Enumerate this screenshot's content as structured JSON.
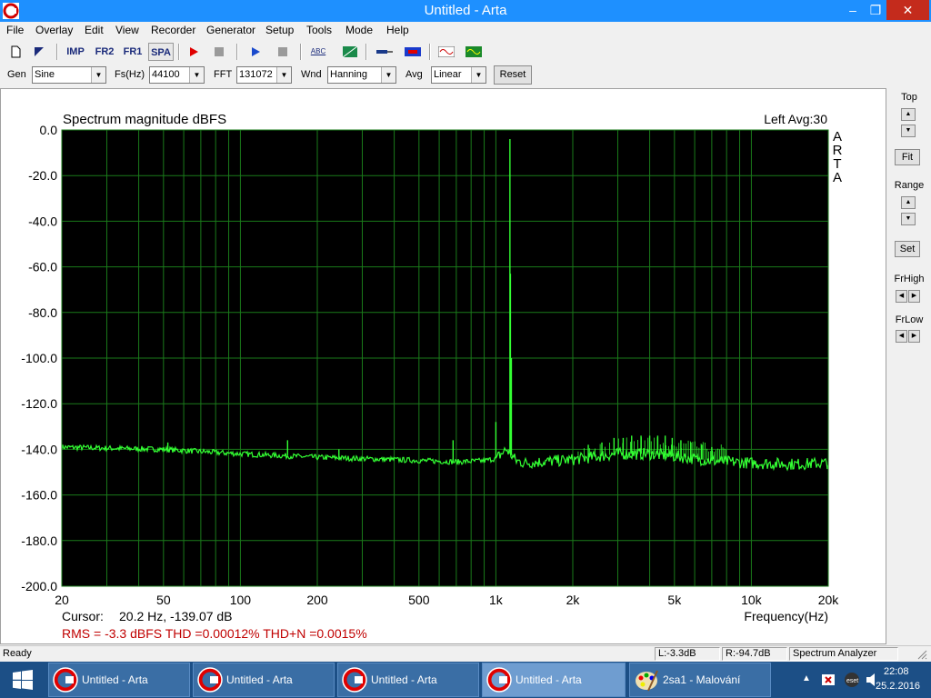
{
  "window": {
    "title": "Untitled - Arta",
    "minimize": "‒",
    "restore": "❐",
    "close": "✕"
  },
  "menu": [
    "File",
    "Overlay",
    "Edit",
    "View",
    "Recorder",
    "Generator",
    "Setup",
    "Tools",
    "Mode",
    "Help"
  ],
  "toolbar": {
    "imp": "IMP",
    "fr2": "FR2",
    "fr1": "FR1",
    "spa": "SPA",
    "abc": "ABC"
  },
  "controls": {
    "gen_label": "Gen",
    "gen_value": "Sine",
    "fs_label": "Fs(Hz)",
    "fs_value": "44100",
    "fft_label": "FFT",
    "fft_value": "131072",
    "wnd_label": "Wnd",
    "wnd_value": "Hanning",
    "avg_label": "Avg",
    "avg_value": "Linear",
    "reset_label": "Reset"
  },
  "plot": {
    "cursor_label": "Cursor:",
    "cursor_value": "20.2 Hz, -139.07 dB",
    "rms_line": "RMS =   -3.3 dBFS   THD =0.00012%   THD+N =0.0015%",
    "watermark": [
      "A",
      "R",
      "T",
      "A"
    ],
    "colors": {
      "background": "#000000",
      "grid": "#1a7a1a",
      "trace": "#33ff33",
      "readout": "#c00000"
    }
  },
  "chart_data": {
    "type": "line",
    "title": "Spectrum magnitude dBFS",
    "channel_info": "Left  Avg:30",
    "xlabel": "Frequency(Hz)",
    "ylabel": "",
    "x_scale": "log",
    "xlim": [
      20,
      20000
    ],
    "ylim": [
      -200,
      0
    ],
    "x_ticks": [
      20,
      50,
      100,
      200,
      500,
      1000,
      2000,
      5000,
      10000,
      20000
    ],
    "x_tick_labels": [
      "20",
      "50",
      "100",
      "200",
      "500",
      "1k",
      "2k",
      "5k",
      "10k",
      "20k"
    ],
    "y_ticks": [
      0,
      -20,
      -40,
      -60,
      -80,
      -100,
      -120,
      -140,
      -160,
      -180,
      -200
    ],
    "y_tick_labels": [
      "0.0",
      "-20.0",
      "-40.0",
      "-60.0",
      "-80.0",
      "-100.0",
      "-120.0",
      "-140.0",
      "-160.0",
      "-180.0",
      "-200.0"
    ],
    "grid": true,
    "series": [
      {
        "x": [
          20,
          30,
          50,
          100,
          200,
          400,
          700,
          900,
          1000,
          1050,
          1100,
          1200,
          1300,
          1500,
          2000,
          3000,
          4000,
          5000,
          7000,
          10000,
          15000,
          20000
        ],
        "y": [
          -139,
          -139.5,
          -140,
          -142,
          -143.5,
          -144.5,
          -145.5,
          -145,
          -144,
          -142,
          -140,
          -145,
          -146,
          -145.5,
          -144.5,
          -142,
          -142,
          -143,
          -145,
          -146,
          -146.5,
          -146
        ],
        "peaks": [
          {
            "x": 52,
            "y": -137
          },
          {
            "x": 153,
            "y": -136
          },
          {
            "x": 243,
            "y": -140
          },
          {
            "x": 680,
            "y": -136
          },
          {
            "x": 1000,
            "y": -128
          },
          {
            "x": 1135,
            "y": -4
          },
          {
            "x": 1140,
            "y": -63
          },
          {
            "x": 1150,
            "y": -100
          },
          {
            "x": 2300,
            "y": -138
          },
          {
            "x": 2600,
            "y": -137
          },
          {
            "x": 2900,
            "y": -135
          },
          {
            "x": 3150,
            "y": -135
          },
          {
            "x": 3400,
            "y": -134
          },
          {
            "x": 3700,
            "y": -134
          },
          {
            "x": 4000,
            "y": -134
          },
          {
            "x": 4300,
            "y": -134
          },
          {
            "x": 4600,
            "y": -134
          },
          {
            "x": 4900,
            "y": -135
          },
          {
            "x": 5300,
            "y": -136
          },
          {
            "x": 5800,
            "y": -137
          },
          {
            "x": 6400,
            "y": -138
          },
          {
            "x": 7000,
            "y": -139
          }
        ]
      }
    ]
  },
  "right_panel": {
    "top_label": "Top",
    "fit_label": "Fit",
    "range_label": "Range",
    "set_label": "Set",
    "frhigh_label": "FrHigh",
    "frlow_label": "FrLow"
  },
  "status": {
    "ready": "Ready",
    "left_level": "L:-3.3dB",
    "right_level": "R:-94.7dB",
    "mode": "Spectrum Analyzer"
  },
  "taskbar": {
    "tasks": [
      "Untitled - Arta",
      "Untitled - Arta",
      "Untitled - Arta",
      "Untitled - Arta",
      "2sa1 - Malování"
    ],
    "time": "22:08",
    "date": "25.2.2016"
  }
}
